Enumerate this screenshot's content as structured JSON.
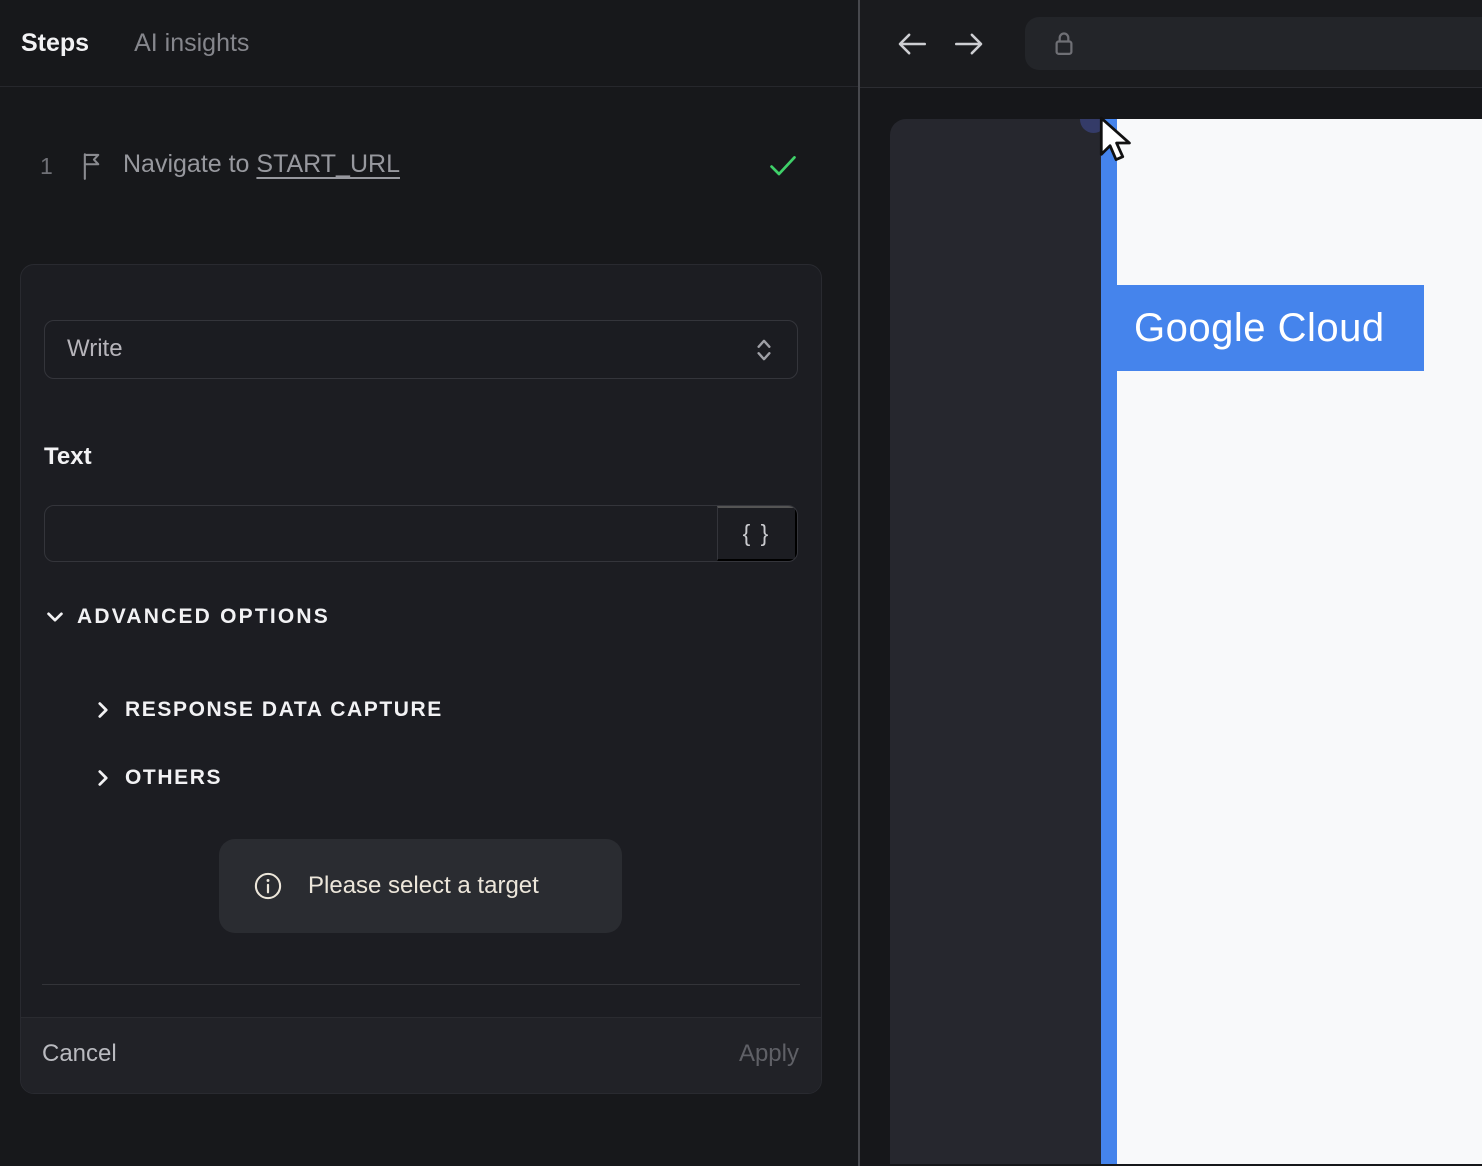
{
  "left_panel": {
    "tabs": [
      {
        "label": "Steps"
      },
      {
        "label": "AI insights"
      }
    ],
    "step": {
      "index": "1",
      "text_prefix": "Navigate to ",
      "link_text": "START_URL",
      "status": "completed"
    },
    "editor": {
      "action_select": {
        "value": "Write"
      },
      "text_label": "Text",
      "text_input": {
        "value": "",
        "placeholder": ""
      },
      "braces_button_label": "{ }",
      "advanced_options_label": "ADVANCED OPTIONS",
      "sections": [
        {
          "label": "RESPONSE DATA CAPTURE"
        },
        {
          "label": "OTHERS"
        }
      ],
      "notice_text": "Please select a target",
      "cancel_label": "Cancel",
      "apply_label": "Apply"
    }
  },
  "browser": {
    "address_bar": {
      "value": "",
      "lock_icon": "lock-icon"
    },
    "page": {
      "highlighted_header_label": "Google Cloud"
    }
  },
  "colors": {
    "accent_blue": "#4584ec",
    "success_green": "#3fd069",
    "notice_text": "#ece6da",
    "panel_bg": "#17181b",
    "card_bg": "#1c1d22",
    "page_white": "#f8f9fa",
    "navy_dot": "#343b68"
  }
}
